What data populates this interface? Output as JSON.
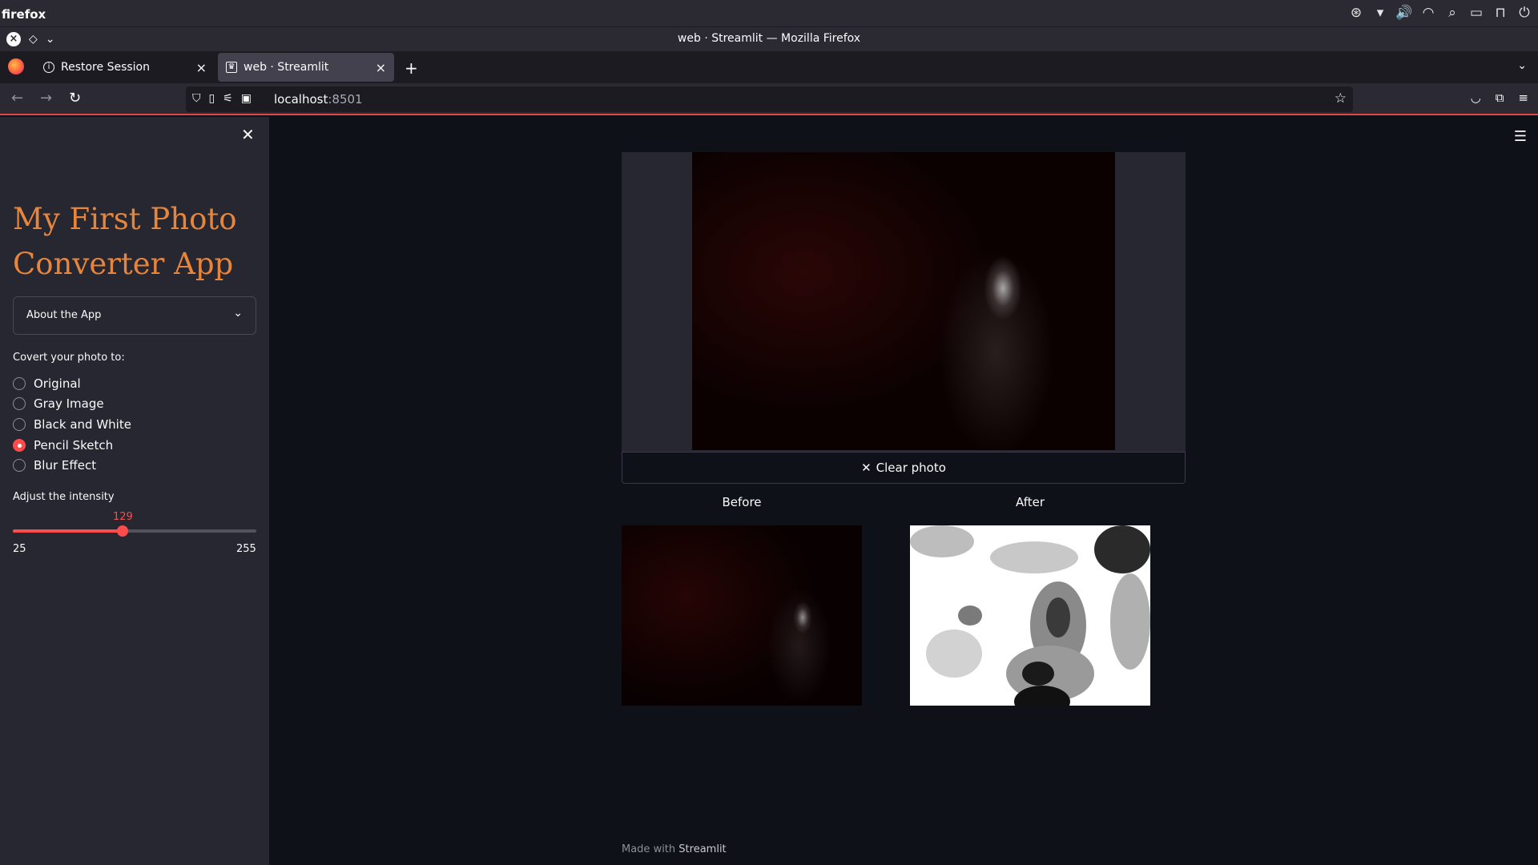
{
  "system": {
    "app_name": "firefox"
  },
  "window": {
    "title": "web · Streamlit — Mozilla Firefox"
  },
  "tabs": [
    {
      "label": "Restore Session",
      "active": false
    },
    {
      "label": "web · Streamlit",
      "active": true
    }
  ],
  "address": {
    "host": "localhost",
    "port": ":8501"
  },
  "sidebar": {
    "title": "My First Photo Converter App",
    "expander_label": "About the App",
    "radio_title": "Covert your photo to:",
    "options": [
      "Original",
      "Gray Image",
      "Black and White",
      "Pencil Sketch",
      "Blur Effect"
    ],
    "selected_option": "Pencil Sketch",
    "slider": {
      "label": "Adjust the intensity",
      "value": "129",
      "min": "25",
      "max": "255",
      "fraction": 0.452
    }
  },
  "main": {
    "clear_label": "Clear photo",
    "before_label": "Before",
    "after_label": "After",
    "footer_prefix": "Made with",
    "footer_brand": "Streamlit"
  },
  "colors": {
    "accent": "#ff4b4b",
    "title": "#e8853d",
    "background": "#0e1117",
    "sidebar": "#262730"
  },
  "icons": [
    "close-icon",
    "chevron-down-icon",
    "hamburger-menu-icon",
    "back-icon",
    "forward-icon",
    "reload-icon",
    "star-icon",
    "shield-icon",
    "pocket-icon",
    "extensions-icon"
  ]
}
